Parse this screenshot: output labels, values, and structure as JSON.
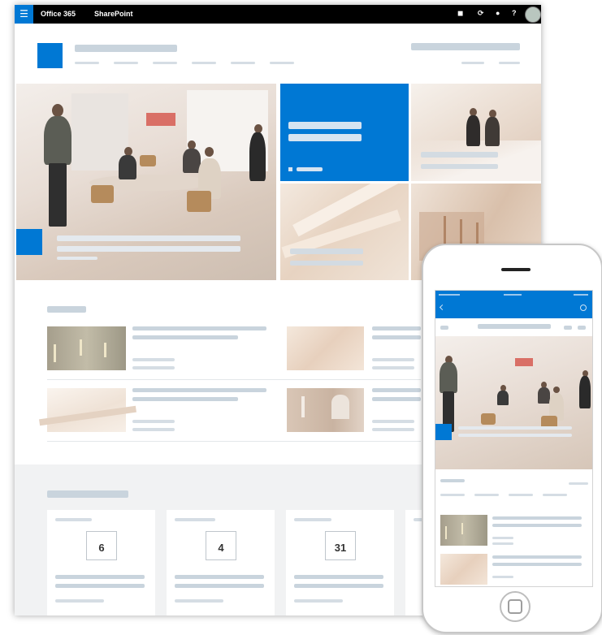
{
  "suite_bar": {
    "waffle_glyph": "☰",
    "brand": "Office 365",
    "app": "SharePoint",
    "icons": [
      "notification-icon",
      "settings-icon",
      "gear-icon",
      "help-icon",
      "avatar"
    ]
  },
  "events": {
    "items": [
      {
        "day": "6"
      },
      {
        "day": "4"
      },
      {
        "day": "31"
      }
    ]
  },
  "colors": {
    "accent": "#0078d4",
    "suite_bar": "#000000",
    "placeholder": "#c9d4dd",
    "events_band": "#f1f2f3"
  }
}
